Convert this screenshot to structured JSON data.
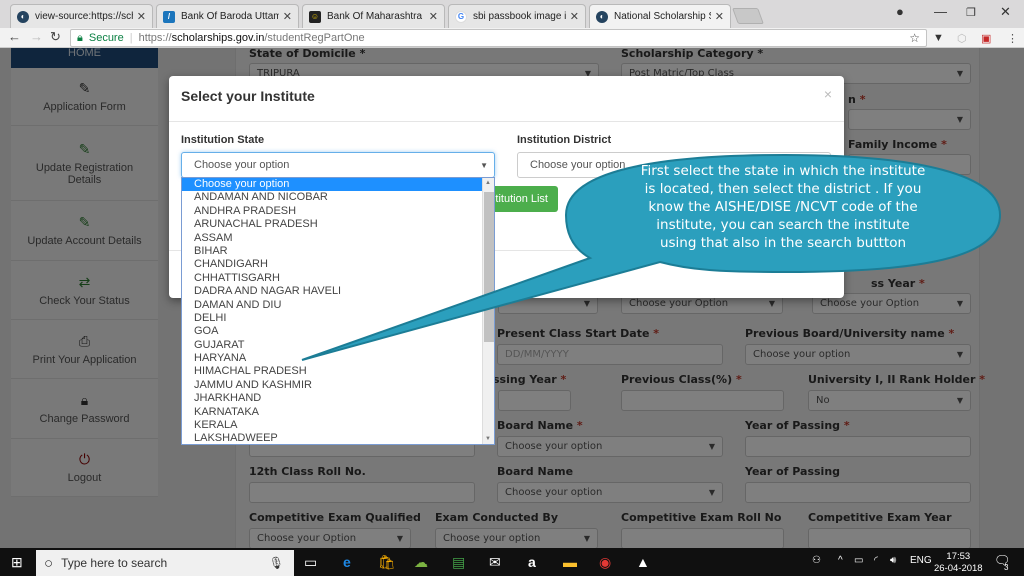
{
  "browser": {
    "tabs": [
      {
        "label": "view-source:https://scho",
        "favicon": "scholarship-icon",
        "active": false
      },
      {
        "label": "Bank Of Baroda Uttam N",
        "favicon": "bob-icon",
        "active": false
      },
      {
        "label": "Bank Of Maharashtra De",
        "favicon": "bom-icon",
        "active": false
      },
      {
        "label": "sbi passbook image in jp",
        "favicon": "google-icon",
        "active": false
      },
      {
        "label": "National Scholarship Sch",
        "favicon": "scholarship-icon",
        "active": true
      }
    ],
    "secure_label": "Secure",
    "url_scheme": "https://",
    "url_host": "scholarships.gov.in",
    "url_path": "/studentRegPartOne"
  },
  "sidebar": {
    "home_label": "HOME",
    "items": [
      {
        "label": "Application Form",
        "icon": "edit-icon",
        "color": "#333333"
      },
      {
        "label": "Update Registration Details",
        "icon": "edit-icon",
        "color": "#2e7d32"
      },
      {
        "label": "Update Account Details",
        "icon": "edit-icon",
        "color": "#2e7d32"
      },
      {
        "label": "Check Your Status",
        "icon": "exchange-icon",
        "color": "#2e7d32"
      },
      {
        "label": "Print Your Application",
        "icon": "print-icon",
        "color": "#333333"
      },
      {
        "label": "Change Password",
        "icon": "lock-icon",
        "color": "#333333"
      },
      {
        "label": "Logout",
        "icon": "power-icon",
        "color": "#8b0000"
      }
    ]
  },
  "form": {
    "state_of_domicile_label": "State of Domicile *",
    "state_of_domicile_value": "TRIPURA",
    "scholarship_category_label": "Scholarship Category *",
    "scholarship_category_value": "Post Matric/Top Class",
    "religion_label_partial": "n",
    "family_income_label": "Family Income",
    "class_year_label_partial": "ss Year",
    "choose_option_cap": "Choose your Option",
    "present_class_start_label": "Present Class Start Date",
    "present_class_start_placeholder": "DD/MM/YYYY",
    "prev_board_label": "Previous Board/University name",
    "prev_board_value": "Choose your option",
    "passing_year_label_partial": "ssing Year",
    "prev_class_pct_label": "Previous Class(%)",
    "rank_holder_label": "University I, II Rank Holder",
    "rank_holder_value": "No",
    "board_name_label": "Board Name",
    "board_name_value": "Choose your option",
    "year_of_passing_label": "Year of Passing",
    "roll_12_label": "12th Class Roll No.",
    "board_name2_label": "Board Name",
    "board_name2_value": "Choose your option",
    "year_of_passing2_label": "Year of Passing",
    "comp_exam_label": "Competitive Exam Qualified",
    "comp_exam_value": "Choose your Option",
    "exam_conducted_label": "Exam Conducted By",
    "exam_conducted_value": "Choose your option",
    "comp_roll_label": "Competitive Exam Roll No",
    "comp_year_label": "Competitive Exam Year",
    "required_marker": "*"
  },
  "modal": {
    "title": "Select your Institute",
    "close": "×",
    "state_label": "Institution State",
    "state_value": "Choose your option",
    "district_label": "Institution District",
    "district_value": "Choose your option",
    "button_label": "stitution List"
  },
  "dropdown": {
    "options": [
      "Choose your option",
      "ANDAMAN AND NICOBAR",
      "ANDHRA PRADESH",
      "ARUNACHAL PRADESH",
      "ASSAM",
      "BIHAR",
      "CHANDIGARH",
      "CHHATTISGARH",
      "DADRA AND NAGAR HAVELI",
      "DAMAN AND DIU",
      "DELHI",
      "GOA",
      "GUJARAT",
      "HARYANA",
      "HIMACHAL PRADESH",
      "JAMMU AND KASHMIR",
      "JHARKHAND",
      "KARNATAKA",
      "KERALA",
      "LAKSHADWEEP"
    ],
    "selected_index": 0
  },
  "callout": {
    "text": "First select the state in which the institute is located, then select the district . If you know the AISHE/DISE /NCVT code of the institute, you can search the institute using that also  in the search buttton",
    "color": "#2b9fbd"
  },
  "taskbar": {
    "search_placeholder": "Type here to search",
    "language": "ENG",
    "time": "17:53",
    "date": "26-04-2018",
    "notification_count": "3"
  }
}
